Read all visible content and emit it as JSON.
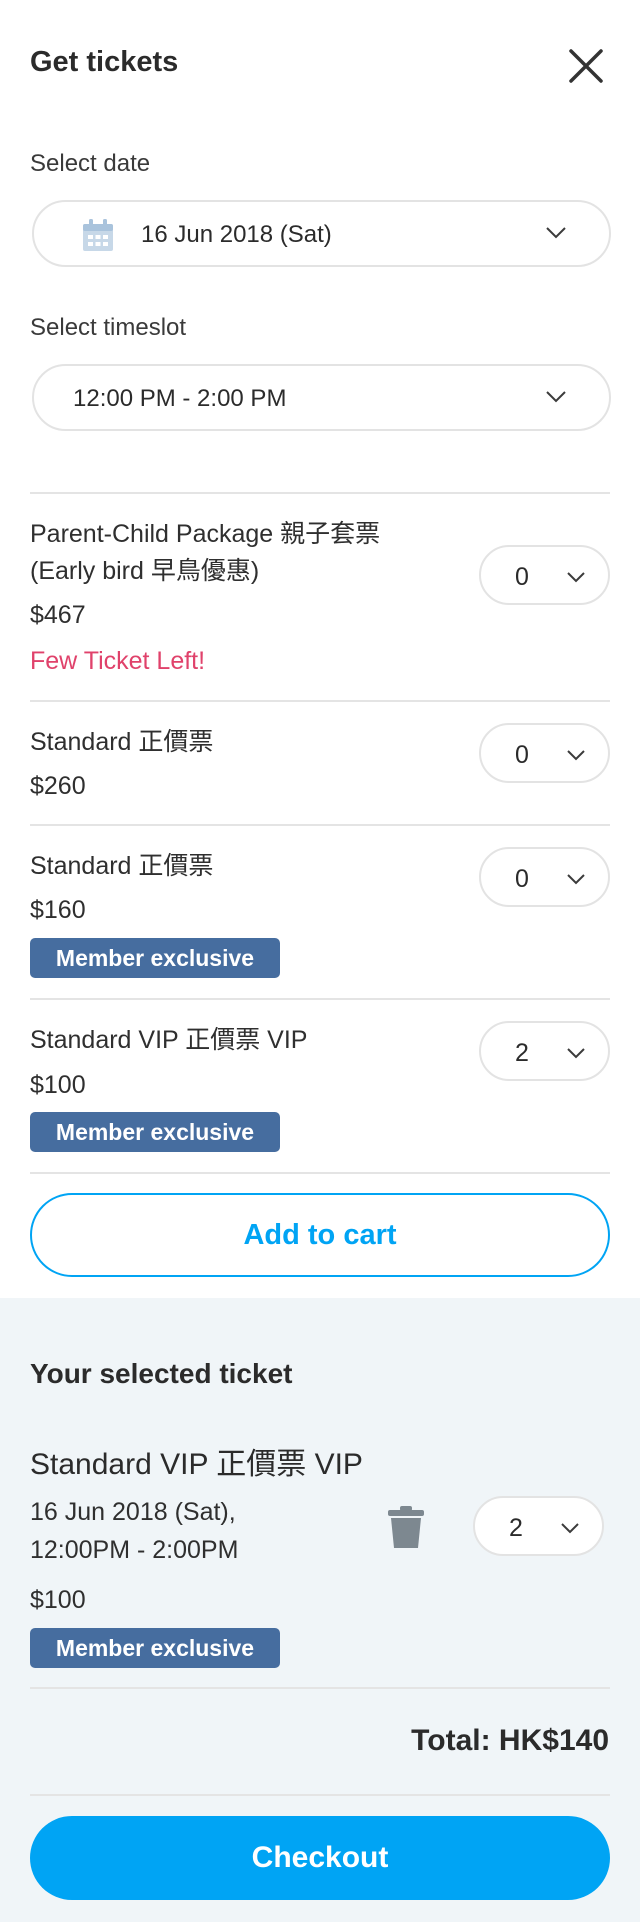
{
  "header": {
    "title": "Get tickets",
    "close_icon": "close-icon"
  },
  "date": {
    "label": "Select date",
    "value": "16 Jun 2018 (Sat)",
    "icon": "calendar-icon"
  },
  "timeslot": {
    "label": "Select timeslot",
    "value": "12:00 PM - 2:00 PM"
  },
  "tickets": [
    {
      "name_line1": "Parent-Child Package 親子套票",
      "name_line2": "(Early bird 早鳥優惠)",
      "price": "$467",
      "note": "Few Ticket Left!",
      "qty": "0"
    },
    {
      "name": "Standard 正價票",
      "price": "$260",
      "qty": "0"
    },
    {
      "name": "Standard 正價票",
      "price": "$160",
      "badge": "Member exclusive",
      "qty": "0"
    },
    {
      "name": "Standard VIP 正價票 VIP",
      "price": "$100",
      "badge": "Member exclusive",
      "qty": "2"
    }
  ],
  "add_to_cart_label": "Add to cart",
  "cart": {
    "title": "Your selected ticket",
    "item": {
      "name": "Standard VIP 正價票 VIP",
      "date_line1": "16 Jun 2018 (Sat),",
      "date_line2": "12:00PM - 2:00PM",
      "price": "$100",
      "badge": "Member exclusive",
      "qty": "2"
    },
    "total": "Total: HK$140",
    "checkout_label": "Checkout"
  },
  "colors": {
    "accent": "#00a4f4",
    "badge": "#466d9f",
    "warning": "#e0426b",
    "cart_bg": "#f0f5f8"
  }
}
